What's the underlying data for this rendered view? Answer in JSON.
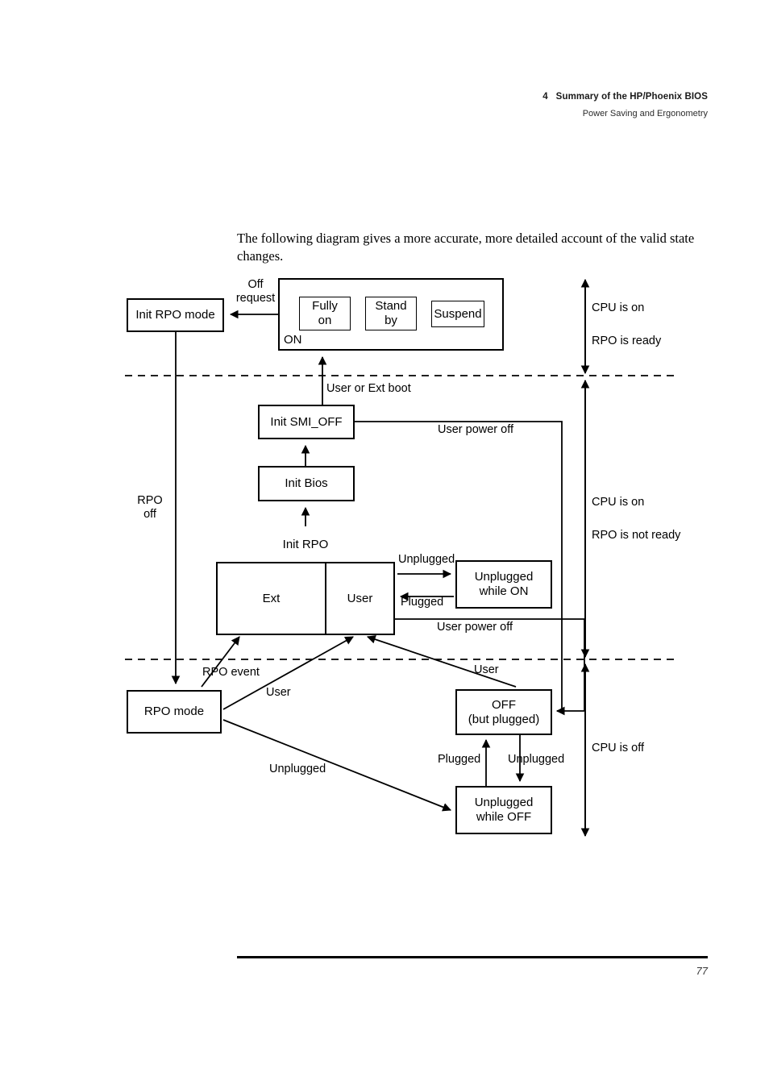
{
  "header": {
    "chapter": "4   Summary of the HP/Phoenix BIOS",
    "subtitle": "Power Saving and Ergonometry"
  },
  "body": {
    "paragraph": "The following diagram gives a more accurate, more detailed account of the valid state changes."
  },
  "diagram": {
    "nodes": {
      "init_rpo_mode": "Init RPO mode",
      "on_group_label": "ON",
      "fully_on": "Fully\non",
      "stand_by": "Stand\nby",
      "suspend": "Suspend",
      "init_smi_off": "Init SMI_OFF",
      "init_bios": "Init Bios",
      "init_rpo": "Init RPO",
      "ext": "Ext",
      "user": "User",
      "unplugged_while_on": "Unplugged\nwhile ON",
      "rpo_mode": "RPO mode",
      "off_but_plugged": "OFF\n(but plugged)",
      "unplugged_while_off": "Unplugged\nwhile OFF"
    },
    "edge_labels": {
      "off_request": "Off\nrequest",
      "user_or_ext_boot": "User or Ext boot",
      "user_power_off_top": "User power off",
      "user_power_off_bottom": "User power off",
      "unplugged_on": "Unplugged",
      "plugged_on": "Plugged",
      "rpo_off": "RPO\noff",
      "rpo_event": "RPO event",
      "user_from_rpo": "User",
      "user_from_off": "User",
      "unplugged_from_rpo": "Unplugged",
      "plugged_off": "Plugged",
      "unplugged_off": "Unplugged"
    },
    "zones": {
      "zone1_line1": "CPU is on",
      "zone1_line2": "RPO is ready",
      "zone2_line1": "CPU is on",
      "zone2_line2": "RPO is not ready",
      "zone3_line1": "CPU is off"
    }
  },
  "footer": {
    "page_number": "77"
  }
}
